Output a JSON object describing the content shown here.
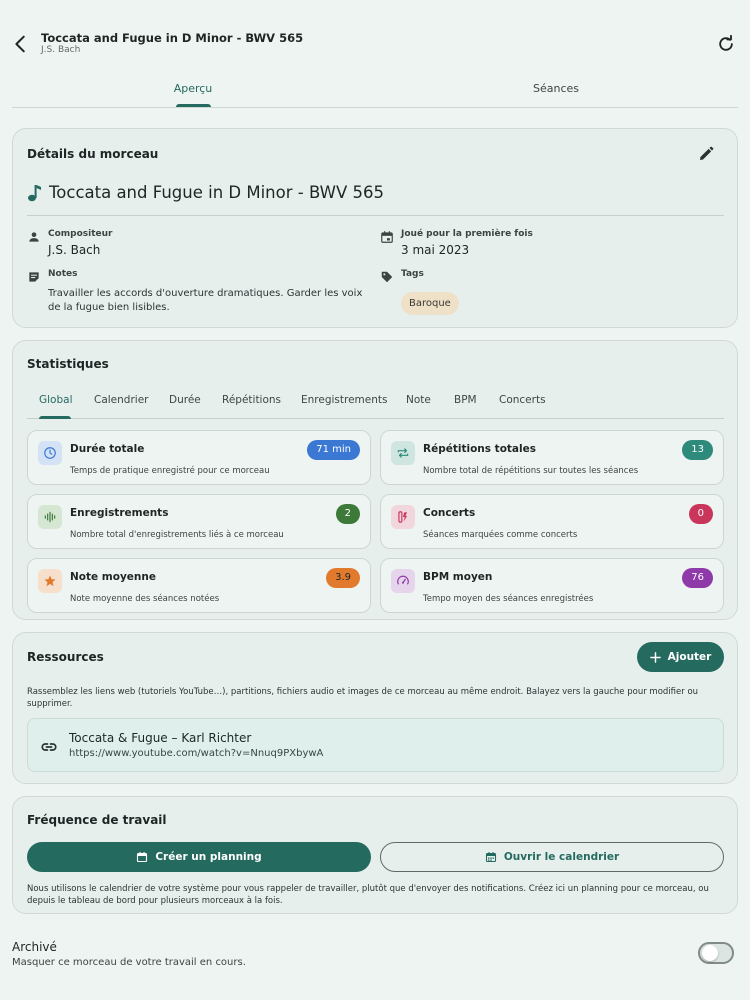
{
  "header": {
    "title": "Toccata and Fugue in D Minor - BWV 565",
    "subtitle": "J.S. Bach"
  },
  "tabs": [
    {
      "label": "Aperçu",
      "active": true
    },
    {
      "label": "Séances",
      "active": false
    }
  ],
  "details": {
    "title": "Détails du morceau",
    "piece_name": "Toccata and Fugue in D Minor - BWV 565",
    "composer_label": "Compositeur",
    "composer_value": "J.S. Bach",
    "first_played_label": "Joué pour la première fois",
    "first_played_value": "3 mai 2023",
    "notes_label": "Notes",
    "notes_value": "Travailler les accords d'ouverture dramatiques. Garder les voix de la fugue bien lisibles.",
    "tags_label": "Tags",
    "tags": [
      "Baroque"
    ]
  },
  "stats": {
    "title": "Statistiques",
    "tabs": [
      "Global",
      "Calendrier",
      "Durée",
      "Répétitions",
      "Enregistrements",
      "Note",
      "BPM",
      "Concerts"
    ],
    "active_tab": "Global",
    "items": [
      {
        "label": "Durée totale",
        "desc": "Temps de pratique enregistré pour ce morceau",
        "value": "71 min",
        "color": "#3a78d4",
        "icon": "clock-icon"
      },
      {
        "label": "Répétitions totales",
        "desc": "Nombre total de répétitions sur toutes les séances",
        "value": "13",
        "color": "#2e8a7a",
        "icon": "repeat-icon"
      },
      {
        "label": "Enregistrements",
        "desc": "Nombre total d'enregistrements liés à ce morceau",
        "value": "2",
        "color": "#3d7a3a",
        "icon": "waveform-icon"
      },
      {
        "label": "Concerts",
        "desc": "Séances marquées comme concerts",
        "value": "0",
        "color": "#c9355b",
        "icon": "concert-icon"
      },
      {
        "label": "Note moyenne",
        "desc": "Note moyenne des séances notées",
        "value": "3.9",
        "color": "#e27a2e",
        "icon": "star-icon"
      },
      {
        "label": "BPM moyen",
        "desc": "Tempo moyen des séances enregistrées",
        "value": "76",
        "color": "#8e3aa8",
        "icon": "gauge-icon"
      }
    ]
  },
  "resources": {
    "title": "Ressources",
    "add_label": "Ajouter",
    "help": "Rassemblez les liens web (tutoriels YouTube…), partitions, fichiers audio et images de ce morceau au même endroit. Balayez vers la gauche pour modifier ou supprimer.",
    "items": [
      {
        "name": "Toccata & Fugue – Karl Richter",
        "url": "https://www.youtube.com/watch?v=Nnuq9PXbywA"
      }
    ]
  },
  "frequency": {
    "title": "Fréquence de travail",
    "plan_label": "Créer un planning",
    "calendar_label": "Ouvrir le calendrier",
    "help": "Nous utilisons le calendrier de votre système pour vous rappeler de travailler, plutôt que d'envoyer des notifications. Créez ici un planning pour ce morceau, ou depuis le tableau de bord pour plusieurs morceaux à la fois."
  },
  "archive": {
    "title": "Archivé",
    "desc": "Masquer ce morceau de votre travail en cours.",
    "enabled": false
  },
  "colors": {
    "accent": "#246a5f",
    "background": "#eef4f2",
    "card": "#e7efed"
  }
}
